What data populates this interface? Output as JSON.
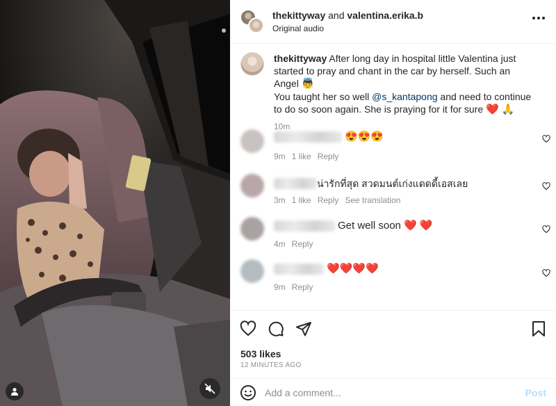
{
  "header": {
    "user1": "thekittyway",
    "conj": "and",
    "user2": "valentina.erika.b",
    "audio": "Original audio"
  },
  "caption": {
    "username": "thekittyway",
    "text1": "After long day in hospital little Valentina just started to pray and chant in the car by herself. Such an Angel",
    "emoji1": "👼",
    "text2": "You taught her so well",
    "mention": "@s_kantapong",
    "text3": "and need to continue to do so soon again. She is praying for it for sure",
    "emoji2": "❤️ 🙏",
    "time": "10m"
  },
  "comments": [
    {
      "text": "😍😍😍",
      "time": "9m",
      "likes": "1 like",
      "reply": "Reply",
      "translate": ""
    },
    {
      "text": "น่ารักที่สุด สวดมนต์เก่งแดดดี้เอสเลย",
      "time": "3m",
      "likes": "1 like",
      "reply": "Reply",
      "translate": "See translation"
    },
    {
      "text": "Get well soon ❤️ ❤️",
      "time": "4m",
      "likes": "",
      "reply": "Reply",
      "translate": ""
    },
    {
      "text": "❤️❤️❤️❤️",
      "time": "9m",
      "likes": "",
      "reply": "Reply",
      "translate": ""
    }
  ],
  "footer": {
    "likes": "503 likes",
    "ago": "12 MINUTES AGO",
    "placeholder": "Add a comment...",
    "post": "Post"
  },
  "icons": [
    "heart-icon",
    "comment-icon",
    "share-icon",
    "bookmark-icon",
    "smile-icon",
    "user-tag-icon",
    "mute-icon",
    "more-icon"
  ],
  "colors": {
    "link": "#00376b",
    "muted": "#8e8e8e",
    "post": "#b2dffc",
    "heart": "#ed4956"
  }
}
